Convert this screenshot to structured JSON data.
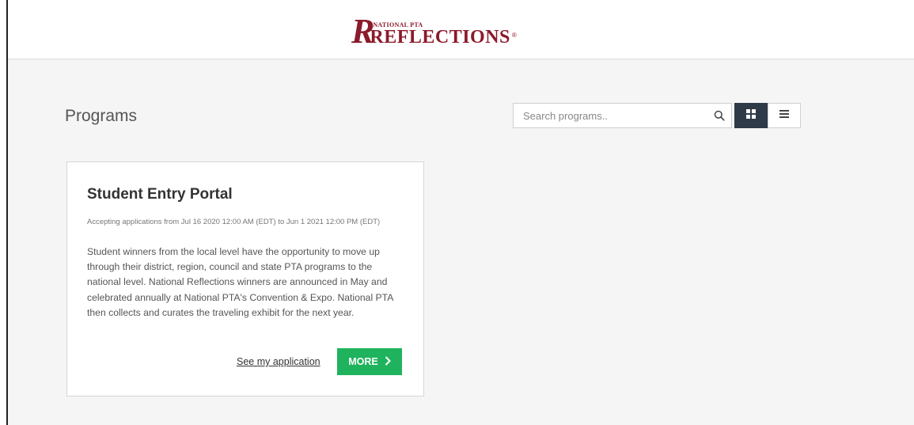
{
  "header": {
    "logo_small": "NATIONAL PTA",
    "logo_main": "REFLECTIONS",
    "logo_registered": "®"
  },
  "page": {
    "title": "Programs"
  },
  "search": {
    "placeholder": "Search programs..",
    "value": ""
  },
  "view_toggle": {
    "active": "grid"
  },
  "programs": [
    {
      "title": "Student Entry Portal",
      "dates": "Accepting applications from Jul 16 2020 12:00 AM (EDT) to Jun 1 2021 12:00 PM (EDT)",
      "description": "Student winners from the local level have the opportunity to move up through their district, region, council and state PTA programs to the national level. National Reflections winners are announced in May and celebrated annually at National PTA's Convention & Expo. National PTA then collects and curates the traveling exhibit for the next year.",
      "link_label": "See my application",
      "button_label": "MORE"
    }
  ],
  "colors": {
    "brand": "#8b1a2b",
    "button_green": "#1fb35d",
    "active_toggle": "#2f3a48"
  },
  "icons": {
    "search": "search-icon",
    "grid": "grid-view-icon",
    "list": "list-view-icon",
    "more": "chevron-right-icon"
  }
}
